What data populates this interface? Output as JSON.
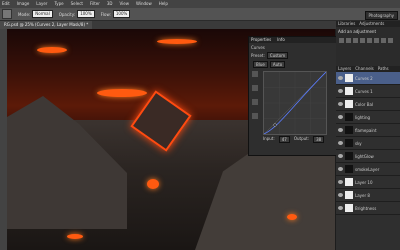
{
  "menubar": {
    "items": [
      "Edit",
      "Image",
      "Layer",
      "Type",
      "Select",
      "Filter",
      "3D",
      "View",
      "Window",
      "Help"
    ]
  },
  "options": {
    "mode_label": "Mode:",
    "mode": "Normal",
    "opacity_label": "Opacity:",
    "opacity": "100%",
    "flow_label": "Flow:",
    "flow": "100%",
    "workspace": "Photography"
  },
  "document": {
    "tab_title": "RG.psd @ 25% (Curves 2, Layer Mask/8) *"
  },
  "properties": {
    "tabs": [
      "Properties",
      "Info"
    ],
    "panel": "Curves",
    "preset_label": "Preset:",
    "preset": "Custom",
    "channel": "Blue",
    "auto": "Auto",
    "input_label": "Input:",
    "input": "47",
    "output_label": "Output:",
    "output": "38"
  },
  "rightdock": {
    "tabs": [
      "Libraries",
      "Adjustments"
    ],
    "adj_title": "Add an adjustment",
    "layer_tabs": [
      "Layers",
      "Channels",
      "Paths"
    ],
    "layers": [
      "Curves 2",
      "Curves 1",
      "Color Bal",
      "lighting",
      "flamepaint",
      "sky",
      "lightGlow",
      "smokeLayer",
      "Layer 10",
      "Layer 8",
      "Brightness"
    ]
  }
}
